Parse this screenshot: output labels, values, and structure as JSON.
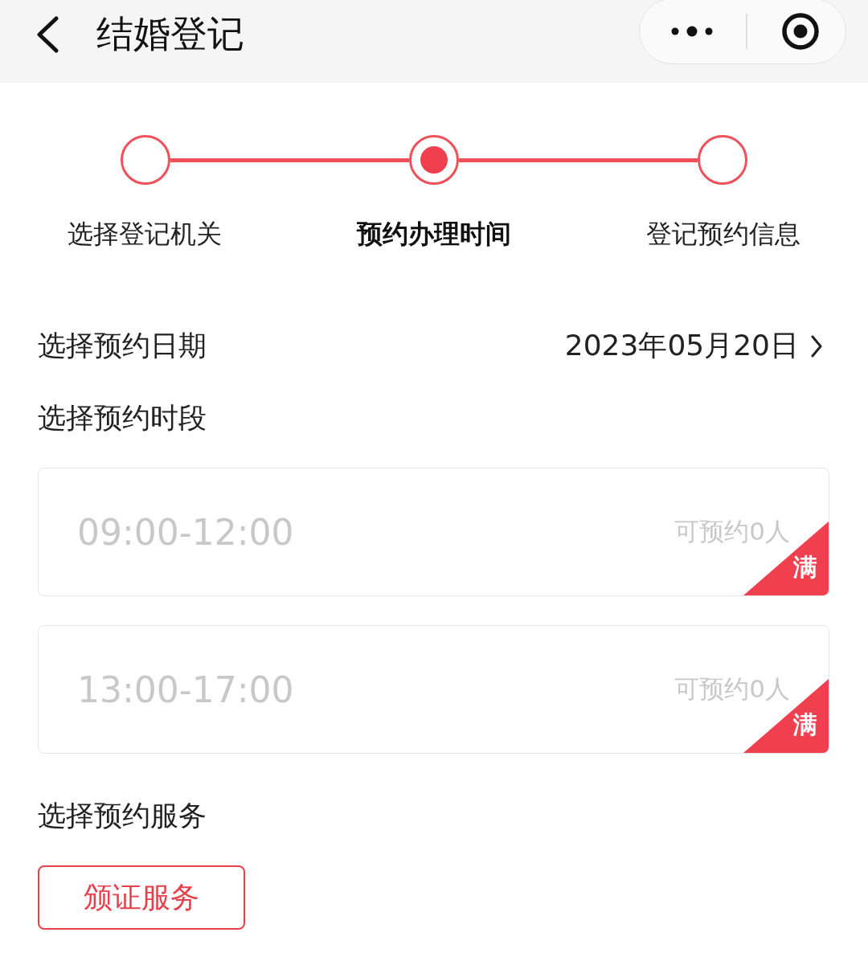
{
  "header": {
    "title": "结婚登记"
  },
  "steps": [
    {
      "label": "选择登记机关",
      "selected": false
    },
    {
      "label": "预约办理时间",
      "selected": true
    },
    {
      "label": "登记预约信息",
      "selected": false
    }
  ],
  "date": {
    "label": "选择预约日期",
    "value": "2023年05月20日"
  },
  "slots_label": "选择预约时段",
  "slots": [
    {
      "time": "09:00-12:00",
      "remaining": "可预约0人",
      "full": true,
      "badge": "满"
    },
    {
      "time": "13:00-17:00",
      "remaining": "可预约0人",
      "full": true,
      "badge": "满"
    }
  ],
  "service_label": "选择预约服务",
  "services": [
    {
      "label": "颁证服务",
      "selected": true
    }
  ]
}
